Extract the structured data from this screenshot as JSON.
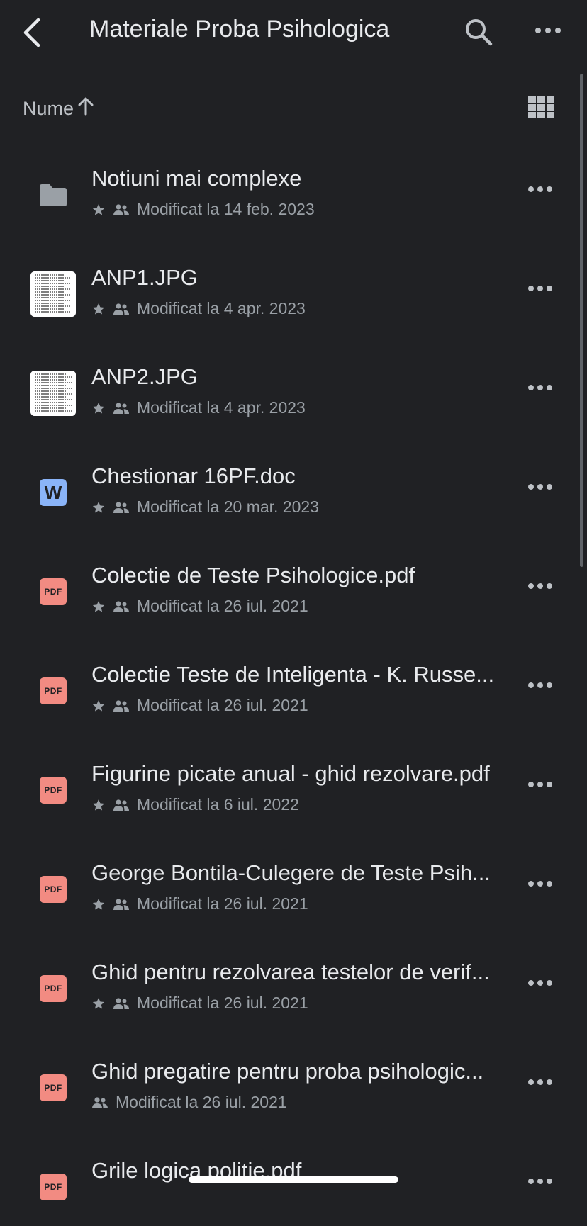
{
  "header": {
    "title": "Materiale Proba Psihologica",
    "back_icon": "back-arrow-icon",
    "search_icon": "search-icon",
    "more_icon": "more-horizontal-icon"
  },
  "sort": {
    "label": "Nume",
    "direction_icon": "arrow-up-icon",
    "view_toggle_icon": "grid-view-icon"
  },
  "colors": {
    "background": "#202124",
    "pdf_icon": "#f28b82",
    "word_icon": "#8ab4f8",
    "folder_icon": "#9aa0a6",
    "secondary_text": "#9aa0a6"
  },
  "files": [
    {
      "name": "Notiuni mai complexe",
      "type": "folder",
      "starred": true,
      "shared": true,
      "modified": "Modificat la 14 feb. 2023"
    },
    {
      "name": "ANP1.JPG",
      "type": "image",
      "starred": true,
      "shared": true,
      "modified": "Modificat la 4 apr. 2023"
    },
    {
      "name": "ANP2.JPG",
      "type": "image",
      "starred": true,
      "shared": true,
      "modified": "Modificat la 4 apr. 2023"
    },
    {
      "name": "Chestionar 16PF.doc",
      "type": "word",
      "icon_text": "W",
      "starred": true,
      "shared": true,
      "modified": "Modificat la 20 mar. 2023"
    },
    {
      "name": "Colectie de Teste Psihologice.pdf",
      "type": "pdf",
      "icon_text": "PDF",
      "starred": true,
      "shared": true,
      "modified": "Modificat la 26 iul. 2021"
    },
    {
      "name": "Colectie Teste de Inteligenta - K. Russe...",
      "type": "pdf",
      "icon_text": "PDF",
      "starred": true,
      "shared": true,
      "modified": "Modificat la 26 iul. 2021"
    },
    {
      "name": "Figurine picate anual - ghid rezolvare.pdf",
      "type": "pdf",
      "icon_text": "PDF",
      "starred": true,
      "shared": true,
      "modified": "Modificat la 6 iul. 2022"
    },
    {
      "name": "George Bontila-Culegere de Teste Psih...",
      "type": "pdf",
      "icon_text": "PDF",
      "starred": true,
      "shared": true,
      "modified": "Modificat la 26 iul. 2021"
    },
    {
      "name": "Ghid pentru rezolvarea testelor de verif...",
      "type": "pdf",
      "icon_text": "PDF",
      "starred": true,
      "shared": true,
      "modified": "Modificat la 26 iul. 2021"
    },
    {
      "name": "Ghid pregatire pentru proba psihologic...",
      "type": "pdf",
      "icon_text": "PDF",
      "starred": false,
      "shared": true,
      "modified": "Modificat la 26 iul. 2021"
    },
    {
      "name": "Grile logica politie.pdf",
      "type": "pdf",
      "icon_text": "PDF",
      "starred": false,
      "shared": false,
      "modified": ""
    }
  ]
}
